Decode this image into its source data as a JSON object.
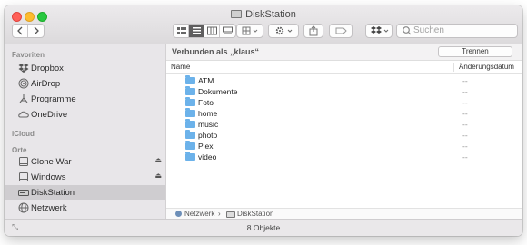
{
  "window": {
    "title": "DiskStation"
  },
  "toolbar": {
    "search_placeholder": "Suchen"
  },
  "sidebar": {
    "sections": [
      {
        "label": "Favoriten"
      },
      {
        "label": "iCloud"
      },
      {
        "label": "Orte"
      }
    ],
    "favorites": [
      {
        "label": "Dropbox",
        "icon": "dropbox-icon"
      },
      {
        "label": "AirDrop",
        "icon": "airdrop-icon"
      },
      {
        "label": "Programme",
        "icon": "applications-icon"
      },
      {
        "label": "OneDrive",
        "icon": "cloud-icon"
      }
    ],
    "locations": [
      {
        "label": "Clone War",
        "icon": "drive-icon",
        "ejectable": true
      },
      {
        "label": "Windows",
        "icon": "drive-icon",
        "ejectable": true
      },
      {
        "label": "DiskStation",
        "icon": "nas-drive-icon",
        "selected": true
      },
      {
        "label": "Netzwerk",
        "icon": "network-globe-icon"
      }
    ]
  },
  "main": {
    "connection_text": "Verbunden als „klaus“",
    "disconnect_label": "Trennen",
    "columns": {
      "name": "Name",
      "date": "Änderungsdatum"
    },
    "items": [
      {
        "name": "ATM",
        "date": "--"
      },
      {
        "name": "Dokumente",
        "date": "--"
      },
      {
        "name": "Foto",
        "date": "--"
      },
      {
        "name": "home",
        "date": "--"
      },
      {
        "name": "music",
        "date": "--"
      },
      {
        "name": "photo",
        "date": "--"
      },
      {
        "name": "Plex",
        "date": "--"
      },
      {
        "name": "video",
        "date": "--"
      }
    ],
    "path": [
      "Netzwerk",
      "DiskStation"
    ]
  },
  "status": {
    "item_count": "8 Objekte"
  },
  "colors": {
    "folder": "#6cb2ea",
    "selection": "#cfcdd0",
    "sidebar_bg": "#e8e6e9"
  }
}
